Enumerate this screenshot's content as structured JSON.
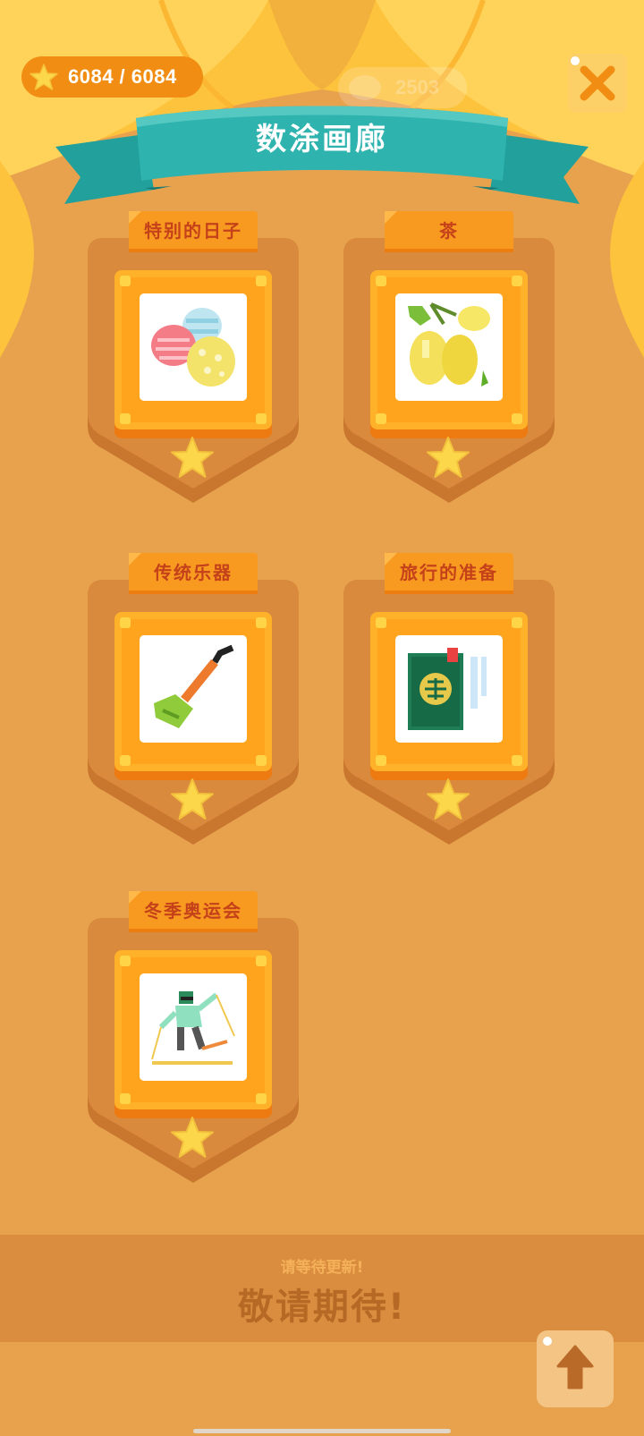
{
  "header": {
    "stars_text": "6084 / 6084",
    "coins_text": "2503",
    "title": "数涂画廊"
  },
  "icons": {
    "star": "star-icon",
    "coin": "coin-icon",
    "close": "close-icon",
    "up": "arrow-up-icon"
  },
  "albums": [
    {
      "label": "特别的日子",
      "thumbnail": "easter-eggs-icon"
    },
    {
      "label": "茶",
      "thumbnail": "lemons-icon"
    },
    {
      "label": "传统乐器",
      "thumbnail": "pipa-instrument-icon"
    },
    {
      "label": "旅行的准备",
      "thumbnail": "passport-icon"
    },
    {
      "label": "冬季奥运会",
      "thumbnail": "skier-icon"
    }
  ],
  "footer": {
    "subtitle": "请等待更新!",
    "message": "敬请期待!"
  },
  "colors": {
    "background": "#E8A24E",
    "accent_orange": "#F08D12",
    "banner_teal": "#2FB3AE",
    "label_red": "#C4411A",
    "star_yellow": "#FCD74A"
  }
}
